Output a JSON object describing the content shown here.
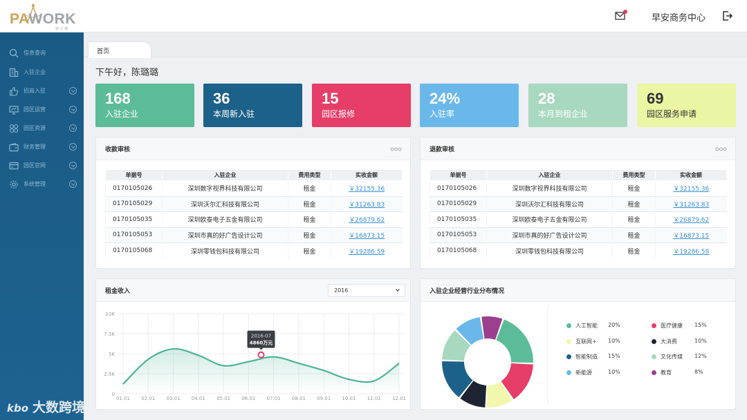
{
  "header": {
    "logo_text_a": "PA",
    "logo_text_b": "WORK",
    "logo_sub": "派 工 场",
    "center_name": "早安商务中心"
  },
  "sidebar": {
    "items": [
      {
        "label": "信息查询",
        "icon": "search-icon",
        "expandable": false
      },
      {
        "label": "入驻企业",
        "icon": "building-icon",
        "expandable": false
      },
      {
        "label": "招商入驻",
        "icon": "thumbs-up-icon",
        "expandable": true
      },
      {
        "label": "园区运营",
        "icon": "monitor-icon",
        "expandable": true
      },
      {
        "label": "园区资源",
        "icon": "grid-icon",
        "expandable": true
      },
      {
        "label": "财务管理",
        "icon": "wallet-icon",
        "expandable": true
      },
      {
        "label": "园区官网",
        "icon": "card-icon",
        "expandable": true
      },
      {
        "label": "系统管理",
        "icon": "gear-icon",
        "expandable": true
      }
    ]
  },
  "watermark": {
    "logo": "kbo",
    "text": "大数跨境"
  },
  "tabs": [
    {
      "label": "首页"
    }
  ],
  "greeting": "下午好，陈璐璐",
  "stats": [
    {
      "value": "168",
      "label": "入驻企业",
      "bg": "#5cbc9a",
      "fg": "#ffffff"
    },
    {
      "value": "36",
      "label": "本周新入驻",
      "bg": "#1c6189",
      "fg": "#ffffff"
    },
    {
      "value": "15",
      "label": "园区报修",
      "bg": "#e63e68",
      "fg": "#ffffff"
    },
    {
      "value": "24%",
      "label": "入驻率",
      "bg": "#6ab8ea",
      "fg": "#ffffff"
    },
    {
      "value": "28",
      "label": "本月到租企业",
      "bg": "#a8d8bf",
      "fg": "#ffffff"
    },
    {
      "value": "69",
      "label": "园区服务申请",
      "bg": "#eaf6a3",
      "fg": "#333333"
    }
  ],
  "collection": {
    "title": "收款审核",
    "columns": [
      "单据号",
      "入驻企业",
      "费用类型",
      "实收金额"
    ],
    "rows": [
      [
        "0170105026",
        "深圳数字视界科技有限公司",
        "租金",
        "￥32155.36"
      ],
      [
        "0170105029",
        "深圳沃尔汇科技有限公司",
        "租金",
        "￥31263.83"
      ],
      [
        "0170105035",
        "深圳欧泰电子五金有限公司",
        "租金",
        "￥26879.62"
      ],
      [
        "0170105053",
        "深圳市真的好广告设计公司",
        "租金",
        "￥16873.15"
      ],
      [
        "0170105068",
        "深圳零钱包科技有限公司",
        "租金",
        "￥19286.59"
      ]
    ]
  },
  "refund": {
    "title": "退款审核",
    "columns": [
      "单据号",
      "入驻企业",
      "费用类型",
      "实收金额"
    ],
    "rows": [
      [
        "0170105026",
        "深圳数字视界科技有限公司",
        "租金",
        "￥32155.36"
      ],
      [
        "0170105029",
        "深圳沃尔汇科技有限公司",
        "租金",
        "￥31263.83"
      ],
      [
        "0170105035",
        "深圳欧泰电子五金有限公司",
        "租金",
        "￥26879.62"
      ],
      [
        "0170105053",
        "深圳市真的好广告设计公司",
        "租金",
        "￥16873.15"
      ],
      [
        "0170105068",
        "深圳零钱包科技有限公司",
        "租金",
        "￥19286.59"
      ]
    ]
  },
  "rent_panel": {
    "title": "租金收入",
    "year": "2016"
  },
  "industry_panel": {
    "title": "入驻企业经营行业分布情况"
  },
  "chart_data": [
    {
      "type": "line",
      "title": "",
      "x": [
        "01.01",
        "02.01",
        "03.01",
        "04.01",
        "05.01",
        "06.01",
        "07.01",
        "08.01",
        "09.01",
        "10.01",
        "11.01",
        "12.01"
      ],
      "y_ticks": [
        "0",
        "2.5K",
        "5K",
        "7.5K",
        "10K"
      ],
      "ylim": [
        0,
        10000
      ],
      "series": [
        {
          "values": [
            1200,
            4300,
            5600,
            4800,
            3500,
            4000,
            4600,
            3800,
            2900,
            1800,
            1600,
            3800
          ]
        }
      ],
      "tooltip": {
        "title": "2016-07",
        "value": "4860万元",
        "y": 4860
      },
      "color": "#4db394",
      "grid": true
    },
    {
      "type": "pie",
      "donut": true,
      "slices": [
        {
          "name": "人工智能",
          "value": 20,
          "label": "20%",
          "color": "#5cbc9a"
        },
        {
          "name": "医疗健康",
          "value": 15,
          "label": "15%",
          "color": "#e63e68"
        },
        {
          "name": "互联网+",
          "value": 10,
          "label": "10%",
          "color": "#f2f7ae"
        },
        {
          "name": "大消费",
          "value": 10,
          "label": "10%",
          "color": "#1f2433"
        },
        {
          "name": "智能制造",
          "value": 15,
          "label": "15%",
          "color": "#1c6189"
        },
        {
          "name": "文化传媒",
          "value": 12,
          "label": "12%",
          "color": "#a8d8bf"
        },
        {
          "name": "新能源",
          "value": 10,
          "label": "10%",
          "color": "#6ab8ea"
        },
        {
          "name": "教育",
          "value": 8,
          "label": "8%",
          "color": "#9c3f8e"
        }
      ],
      "legend_position": "right"
    }
  ]
}
